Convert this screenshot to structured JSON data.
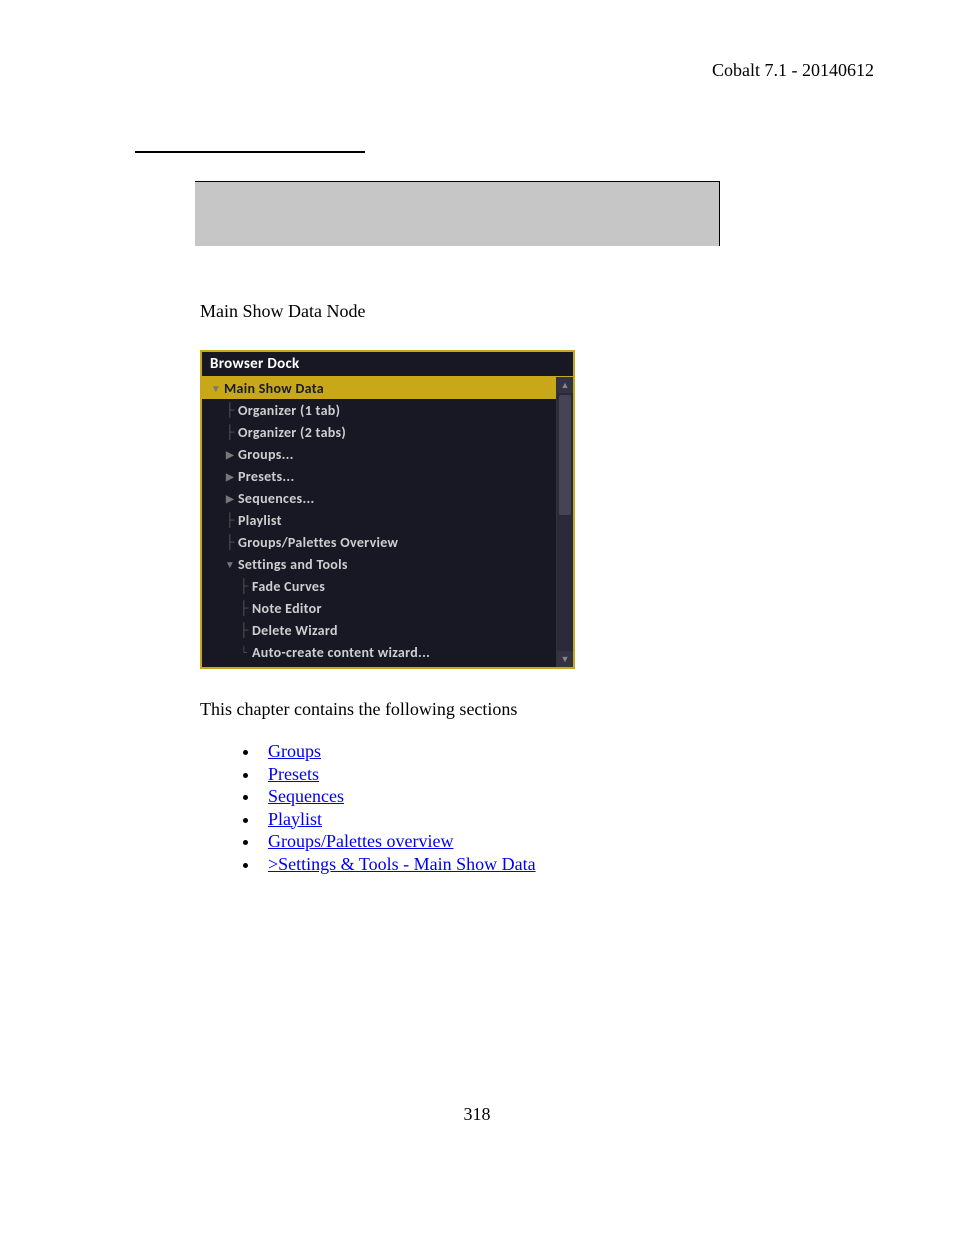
{
  "header": "Cobalt 7.1 - 20140612",
  "section_title": "Main Show Data Node",
  "dock": {
    "title": "Browser Dock",
    "root": "Main Show Data",
    "items": [
      {
        "label": "Organizer (1 tab)",
        "type": "leaf"
      },
      {
        "label": "Organizer (2 tabs)",
        "type": "leaf"
      },
      {
        "label": "Groups...",
        "type": "collapsed"
      },
      {
        "label": "Presets...",
        "type": "collapsed"
      },
      {
        "label": "Sequences...",
        "type": "collapsed"
      },
      {
        "label": "Playlist",
        "type": "leaf"
      },
      {
        "label": "Groups/Palettes Overview",
        "type": "leaf"
      },
      {
        "label": "Settings and Tools",
        "type": "expanded"
      }
    ],
    "subitems": [
      "Fade Curves",
      "Note Editor",
      "Delete Wizard",
      "Auto-create content wizard..."
    ]
  },
  "intro": "This chapter contains the following sections",
  "links": [
    "Groups",
    "Presets",
    "Sequences",
    "Playlist",
    "Groups/Palettes overview",
    ">Settings & Tools - Main Show Data"
  ],
  "page_number": "318"
}
